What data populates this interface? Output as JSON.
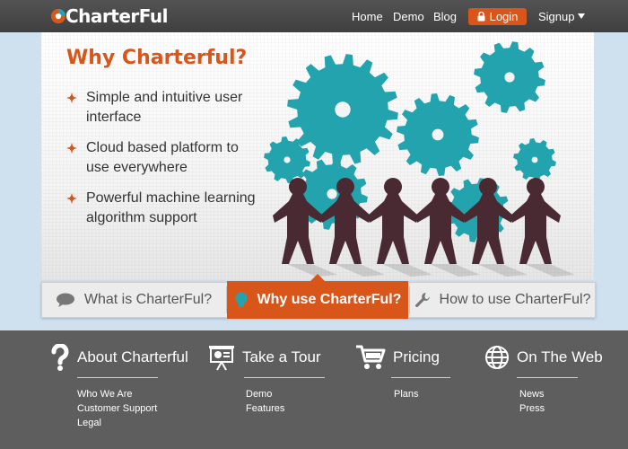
{
  "header": {
    "logo_text": "CharterFul",
    "nav": [
      "Home",
      "Demo",
      "Blog"
    ],
    "login_label": "Login",
    "signup_label": "Signup"
  },
  "hero": {
    "title": "Why Charterful?",
    "features": [
      "Simple and intuitive user interface",
      "Cloud based platform to use everywhere",
      "Powerful machine learning algorithm support"
    ]
  },
  "tabs": [
    {
      "label": "What is CharterFul?",
      "active": false
    },
    {
      "label": "Why use CharterFul?",
      "active": true
    },
    {
      "label": "How to use CharterFul?",
      "active": false
    }
  ],
  "footer": {
    "columns": [
      {
        "title": "About Charterful",
        "links": [
          "Who We Are",
          "Customer Support",
          "Legal"
        ]
      },
      {
        "title": "Take a Tour",
        "links": [
          "Demo",
          "Features"
        ]
      },
      {
        "title": "Pricing",
        "links": [
          "Plans"
        ]
      },
      {
        "title": "On The Web",
        "links": [
          "News",
          "Press"
        ]
      }
    ]
  },
  "colors": {
    "accent": "#d9561b",
    "gear": "#23a3ae",
    "figure": "#4a2a32",
    "nav_bg": "#454545",
    "footer_bg": "#5e5e5e",
    "page_bg": "#cfe0ee"
  }
}
